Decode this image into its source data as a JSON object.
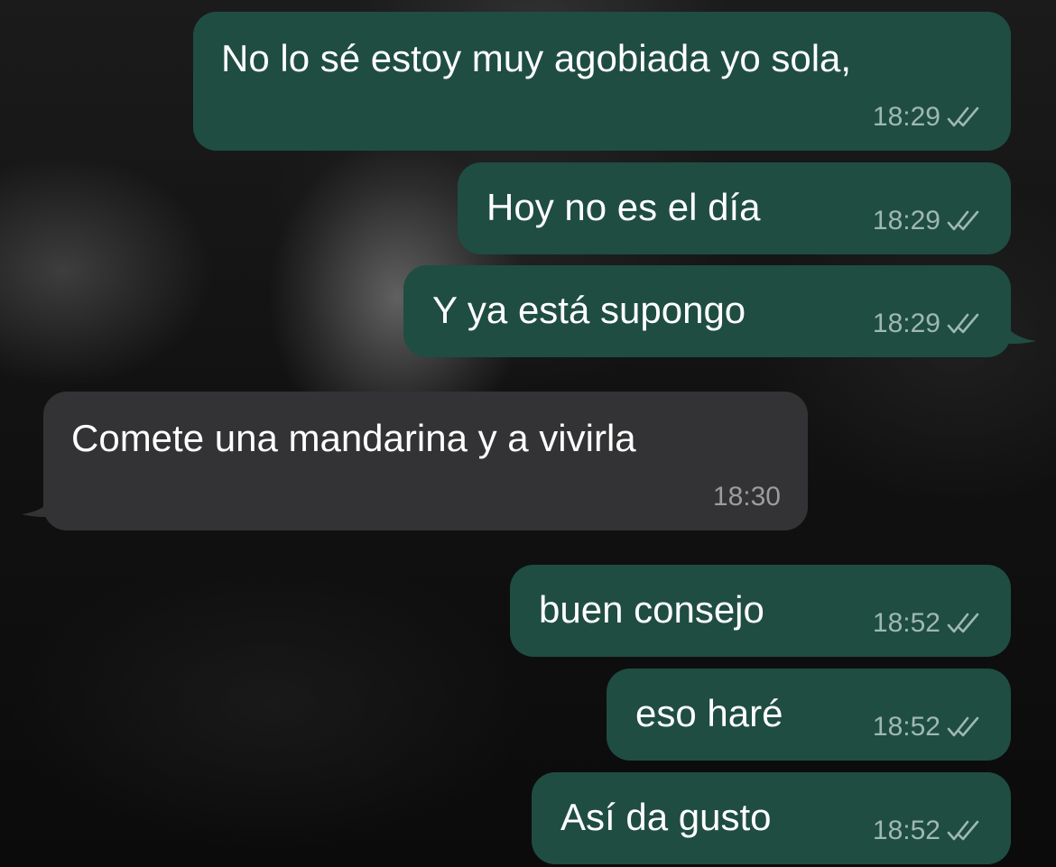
{
  "messages": [
    {
      "text": "No lo sé estoy muy agobiada yo sola,",
      "time": "18:29",
      "direction": "outgoing",
      "status_icon": "double-check-icon"
    },
    {
      "text": "Hoy no es el día",
      "time": "18:29",
      "direction": "outgoing",
      "status_icon": "double-check-icon"
    },
    {
      "text": "Y ya está supongo",
      "time": "18:29",
      "direction": "outgoing",
      "status_icon": "double-check-icon"
    },
    {
      "text": "Comete una mandarina y a vivirla",
      "time": "18:30",
      "direction": "incoming"
    },
    {
      "text": "buen consejo",
      "time": "18:52",
      "direction": "outgoing",
      "status_icon": "double-check-icon"
    },
    {
      "text": "eso haré",
      "time": "18:52",
      "direction": "outgoing",
      "status_icon": "double-check-icon"
    },
    {
      "text": "Así da gusto",
      "time": "18:52",
      "direction": "outgoing",
      "status_icon": "double-check-icon"
    }
  ],
  "colors": {
    "outgoing_bubble": "#1f4d42",
    "incoming_bubble": "#333335",
    "text": "#ffffff",
    "outgoing_meta": "#9fb8b1",
    "incoming_meta": "#9c9c9c"
  }
}
